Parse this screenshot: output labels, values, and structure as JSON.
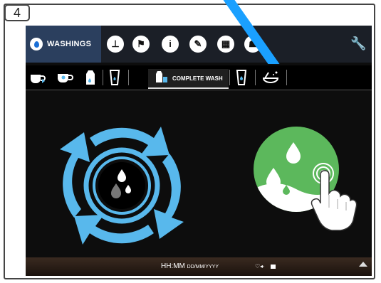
{
  "step": {
    "number": "4"
  },
  "topbar": {
    "active_tab": {
      "label": "WASHINGS",
      "icon": "drop-icon"
    },
    "icons": [
      {
        "name": "clock-icon",
        "glyph": "⊥"
      },
      {
        "name": "flag-icon",
        "glyph": "⚑"
      },
      {
        "name": "info-icon",
        "glyph": "i"
      },
      {
        "name": "pencil-icon",
        "glyph": "✎"
      },
      {
        "name": "calculator-icon",
        "glyph": "▦"
      },
      {
        "name": "user-icon",
        "glyph": "☗"
      }
    ],
    "settings_icon": "wrench-icon",
    "wrench_glyph": "🔧"
  },
  "subbar": {
    "selected_label": "COMPLETE WASH",
    "icons": [
      "coffee-wash-icon",
      "cup-icon",
      "milk-carton-icon",
      "glass-icon",
      "milk-wash-icon",
      "glass-drop-icon",
      "cleaning-icon"
    ]
  },
  "statusbar": {
    "time": "HH:MM",
    "date": "DD/MM/YYYY",
    "indicators": "♡◂·"
  },
  "colors": {
    "accent_blue": "#58b8ec",
    "green": "#5cb85c",
    "deco_blue": "#1aa0ff"
  }
}
